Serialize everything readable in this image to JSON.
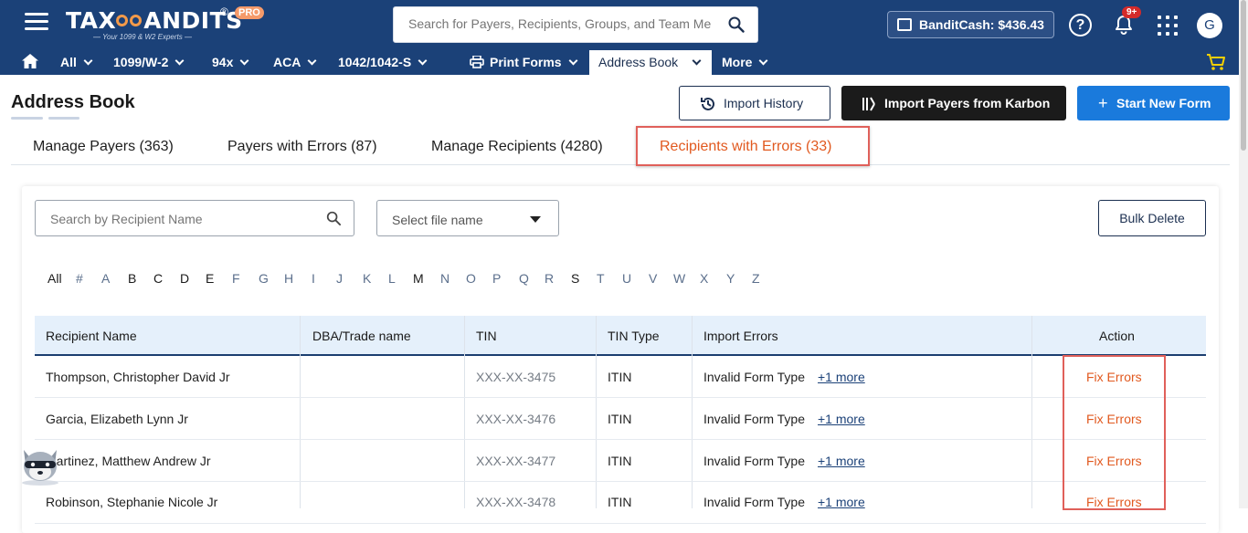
{
  "header": {
    "brand_left": "TAX",
    "brand_right": "ANDITS",
    "registered": "®",
    "pro_badge": "PRO",
    "tagline": "— Your 1099 & W2 Experts —",
    "search_placeholder": "Search for Payers, Recipients, Groups, and Team Me",
    "bandit_cash": "BanditCash: $436.43",
    "help_glyph": "?",
    "notification_badge": "9+",
    "avatar_initial": "G"
  },
  "nav": {
    "items": [
      {
        "label": "All"
      },
      {
        "label": "1099/W-2"
      },
      {
        "label": "94x"
      },
      {
        "label": "ACA"
      },
      {
        "label": "1042/1042-S"
      },
      {
        "label": "Print Forms"
      }
    ],
    "active": "Address Book",
    "more": "More"
  },
  "page": {
    "title": "Address Book",
    "import_history": "Import History",
    "import_karbon": "Import Payers from Karbon",
    "start_new_form": "Start New Form"
  },
  "tabs": [
    {
      "label": "Manage Payers (363)"
    },
    {
      "label": "Payers with Errors (87)"
    },
    {
      "label": "Manage Recipients (4280)"
    },
    {
      "label": "Recipients with Errors (33)"
    }
  ],
  "filters": {
    "search_placeholder": "Search by Recipient Name",
    "file_select": "Select file name",
    "bulk_delete": "Bulk Delete"
  },
  "alphabet": [
    "All",
    "#",
    "A",
    "B",
    "C",
    "D",
    "E",
    "F",
    "G",
    "H",
    "I",
    "J",
    "K",
    "L",
    "M",
    "N",
    "O",
    "P",
    "Q",
    "R",
    "S",
    "T",
    "U",
    "V",
    "W",
    "X",
    "Y",
    "Z"
  ],
  "alphabet_bold": [
    "All",
    "B",
    "C",
    "D",
    "E",
    "M",
    "S"
  ],
  "table": {
    "columns": [
      "Recipient Name",
      "DBA/Trade name",
      "TIN",
      "TIN Type",
      "Import Errors",
      "Action"
    ],
    "rows": [
      {
        "name": "Thompson, Christopher David Jr",
        "dba": "",
        "tin": "XXX-XX-3475",
        "tin_type": "ITIN",
        "error": "Invalid Form Type",
        "more": "+1 more",
        "action": "Fix Errors"
      },
      {
        "name": "Garcia, Elizabeth Lynn Jr",
        "dba": "",
        "tin": "XXX-XX-3476",
        "tin_type": "ITIN",
        "error": "Invalid Form Type",
        "more": "+1 more",
        "action": "Fix Errors"
      },
      {
        "name": "Martinez, Matthew Andrew Jr",
        "dba": "",
        "tin": "XXX-XX-3477",
        "tin_type": "ITIN",
        "error": "Invalid Form Type",
        "more": "+1 more",
        "action": "Fix Errors"
      },
      {
        "name": "Robinson, Stephanie Nicole Jr",
        "dba": "",
        "tin": "XXX-XX-3478",
        "tin_type": "ITIN",
        "error": "Invalid Form Type",
        "more": "+1 more",
        "action": "Fix Errors"
      }
    ]
  },
  "colors": {
    "header_bg": "#1b4178",
    "accent_orange": "#e1591f",
    "primary_blue": "#1a7adc",
    "highlight_red": "#e0605a"
  }
}
